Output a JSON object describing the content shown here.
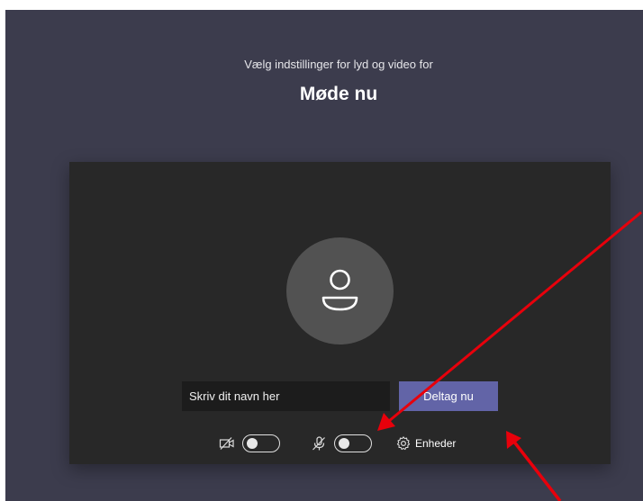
{
  "header": {
    "subtitle": "Vælg indstillinger for lyd og video for",
    "meeting_title": "Møde nu"
  },
  "preview": {
    "avatar_icon": "person-icon",
    "name_input": {
      "placeholder": "Skriv dit navn her",
      "value": ""
    },
    "join_button_label": "Deltag nu"
  },
  "controls": {
    "camera": {
      "icon": "camera-off-icon",
      "on": false
    },
    "microphone": {
      "icon": "mic-off-icon",
      "on": false
    },
    "devices": {
      "icon": "gear-icon",
      "label": "Enheder"
    }
  },
  "colors": {
    "background": "#3c3c4d",
    "panel": "#282828",
    "accent": "#6264a7",
    "annotation_arrow": "#e8000b"
  }
}
